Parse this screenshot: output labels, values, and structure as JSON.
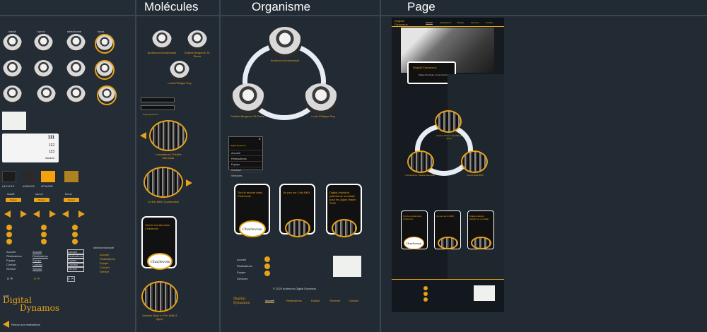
{
  "columns": {
    "molecules": "Molécules",
    "organisme": "Organisme",
    "page": "Page"
  },
  "atoms": {
    "states": [
      "inactif",
      "survol",
      "sélectionné",
      "focus"
    ],
    "colors": [
      "#1C1C1C",
      "#2A2A2A",
      "#F5A20D",
      "#B0821F"
    ],
    "color_labels": [
      "#1C1C1C",
      "#2A2A2A",
      "#F5A20D"
    ],
    "button_states": [
      "inactif",
      "survol",
      "focus"
    ],
    "button_label": "Bouton",
    "ranking_numbers": [
      "111",
      "112",
      "113"
    ],
    "nav_items": [
      "Accueil",
      "Réalisations",
      "Equipe",
      "Contact",
      "Service"
    ],
    "selection_label": "sélectionné/actif",
    "logo_caption": "Logo",
    "logo_line1": "Digital",
    "logo_line2": "Dynamos",
    "back_link": "Retour aux réalisations"
  },
  "molecules": {
    "people": [
      "Anderson Archambault",
      "Clotilde Bergeron St-Pierre",
      "Louis-Philippe Roy"
    ],
    "project1": "L'expérience Théâtre Memorial",
    "project2": "Le Bar BMX Countryside",
    "article_title": "Tout le monde dans Charlevoix",
    "article_logo": "Charlevoix",
    "project3": "Another Brick In The Wall (1 ligne)",
    "menu_header": "Digital Dynamos",
    "menu_items": [
      "Accueil",
      "Réalisations",
      "Equipe",
      "Contact",
      "Services"
    ],
    "menu_close": "✕",
    "logo_small": "Digital Dynamos"
  },
  "organisme": {
    "people": [
      "Anderson Archambault",
      "Clotilde Bergeron St-Pierre",
      "Louis-Philippe Roy"
    ],
    "card_titles": [
      "Tout le monde dans Charlevoix",
      "Un peu sur Cela BMX",
      "Digital-Industrie, plateforme mondiale pour les Apple Watch 2020"
    ],
    "card_logo": "Charlevoix",
    "footer_labels": [
      "Accueil",
      "Réalisations",
      "Equipe",
      "Services"
    ],
    "footer_nav": [
      "Accueil",
      "Réalisations",
      "Équipe",
      "Services",
      "Contact"
    ],
    "logo_small": "Digital Dynamos",
    "copyright": "© 2020 Anderson Digital Dynamos"
  },
  "page": {
    "nav": [
      "Accueil",
      "Réalisations",
      "Équipe",
      "Services",
      "Contact"
    ],
    "hero_title": "Digital Dynamos",
    "hero_sub": "Shape the future of communication",
    "projects": [
      "Another Brick in the Wall (1 ligne)",
      "L'expérience Théâtre Memorial",
      "Countryside BMX"
    ],
    "card_titles": [
      "Tout le monde dans Charlevoix",
      "Un peu sur le BMX",
      "Digital-Industrie plateforme mondiale"
    ],
    "card_logo": "Charlevoix"
  }
}
